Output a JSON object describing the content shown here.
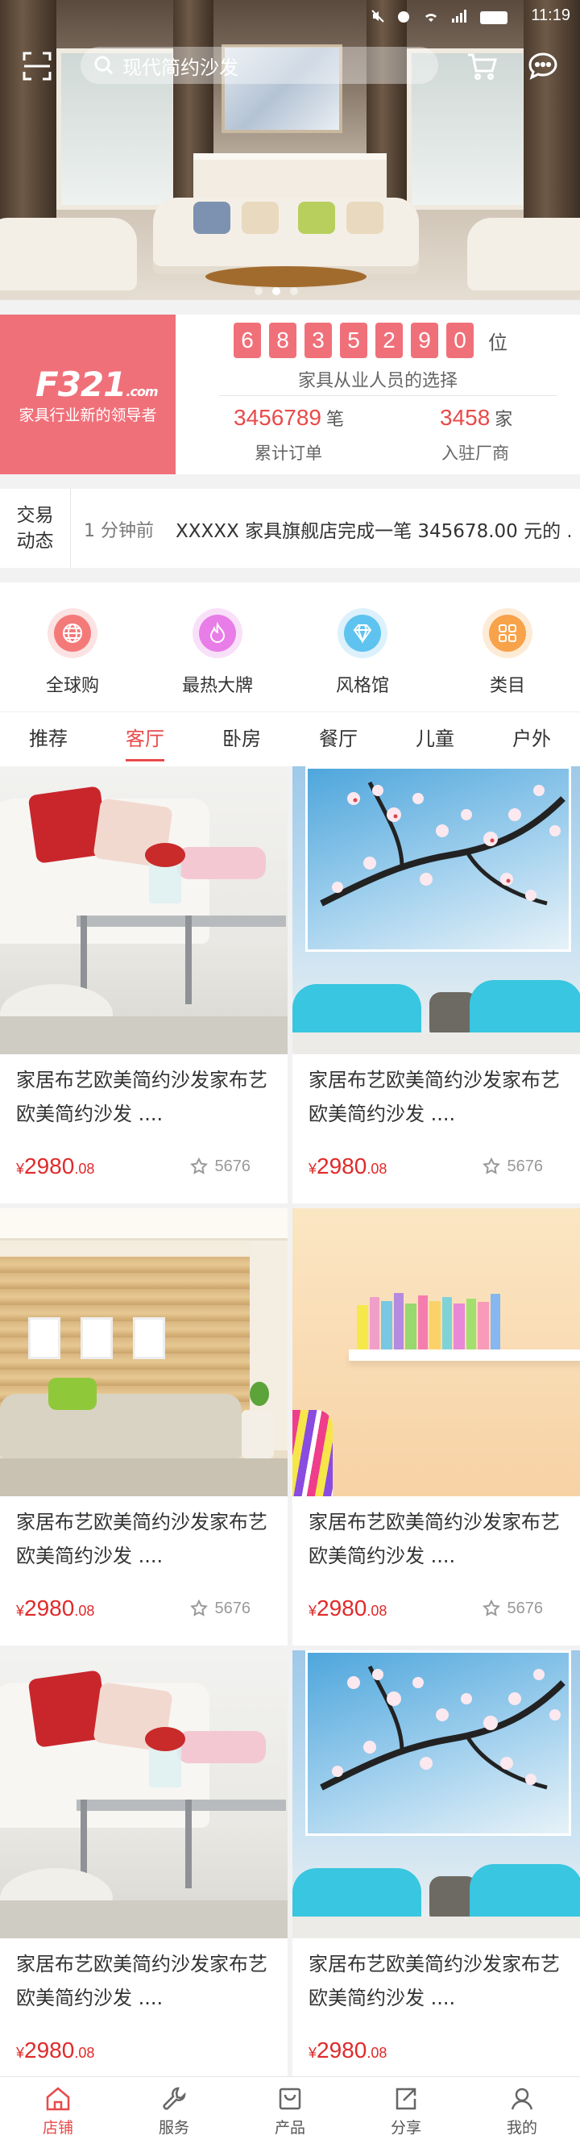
{
  "status_bar": {
    "time": "11:19"
  },
  "search": {
    "placeholder": "现代简约沙发"
  },
  "banner": {
    "slide_count": 3,
    "active_slide": 2
  },
  "stats": {
    "brand_logo": "F321",
    "brand_logo_suffix": ".com",
    "brand_slogan": "家具行业新的领导者",
    "counter_digits": [
      "6",
      "8",
      "3",
      "5",
      "2",
      "9",
      "0"
    ],
    "counter_unit": "位",
    "caption": "家具从业人员的选择",
    "orders_value": "3456789",
    "orders_unit": "笔",
    "orders_label": "累计订单",
    "vendors_value": "3458",
    "vendors_unit": "家",
    "vendors_label": "入驻厂商"
  },
  "ticker": {
    "tag_line1": "交易",
    "tag_line2": "动态",
    "time": "1 分钟前",
    "message": "XXXXX 家具旗舰店完成一笔 345678.00 元的 .."
  },
  "categories": [
    {
      "label": "全球购",
      "icon": "globe-icon",
      "color": "#f47a7a"
    },
    {
      "label": "最热大牌",
      "icon": "flame-icon",
      "color": "#e87de8"
    },
    {
      "label": "风格馆",
      "icon": "diamond-icon",
      "color": "#5ec3ef"
    },
    {
      "label": "类目",
      "icon": "grid-icon",
      "color": "#f8a24a"
    }
  ],
  "tabs": [
    "推荐",
    "客厅",
    "卧房",
    "餐厅",
    "儿童",
    "户外"
  ],
  "active_tab": 1,
  "products": [
    {
      "title": "家居布艺欧美简约沙发家布艺欧美简约沙发 ....",
      "currency": "¥",
      "price_int": "2980",
      "price_dec": ".08",
      "favorites": "5676",
      "image": "sofa"
    },
    {
      "title": "家居布艺欧美简约沙发家布艺欧美简约沙发 ....",
      "currency": "¥",
      "price_int": "2980",
      "price_dec": ".08",
      "favorites": "5676",
      "image": "blossom"
    },
    {
      "title": "家居布艺欧美简约沙发家布艺欧美简约沙发 ....",
      "currency": "¥",
      "price_int": "2980",
      "price_dec": ".08",
      "favorites": "5676",
      "image": "wood"
    },
    {
      "title": "家居布艺欧美简约沙发家布艺欧美简约沙发 ....",
      "currency": "¥",
      "price_int": "2980",
      "price_dec": ".08",
      "favorites": "5676",
      "image": "shelf"
    },
    {
      "title": "家居布艺欧美简约沙发家布艺欧美简约沙发 ....",
      "currency": "¥",
      "price_int": "2980",
      "price_dec": ".08",
      "favorites": "",
      "image": "sofa"
    },
    {
      "title": "家居布艺欧美简约沙发家布艺欧美简约沙发 ....",
      "currency": "¥",
      "price_int": "2980",
      "price_dec": ".08",
      "favorites": "",
      "image": "blossom"
    }
  ],
  "bottom_nav": [
    {
      "label": "店铺",
      "icon": "home-icon",
      "active": true
    },
    {
      "label": "服务",
      "icon": "wrench-icon",
      "active": false
    },
    {
      "label": "产品",
      "icon": "box-icon",
      "active": false
    },
    {
      "label": "分享",
      "icon": "share-icon",
      "active": false
    },
    {
      "label": "我的",
      "icon": "user-icon",
      "active": false
    }
  ],
  "colors": {
    "accent": "#e84a4a",
    "brand_pink": "#f0707a"
  }
}
